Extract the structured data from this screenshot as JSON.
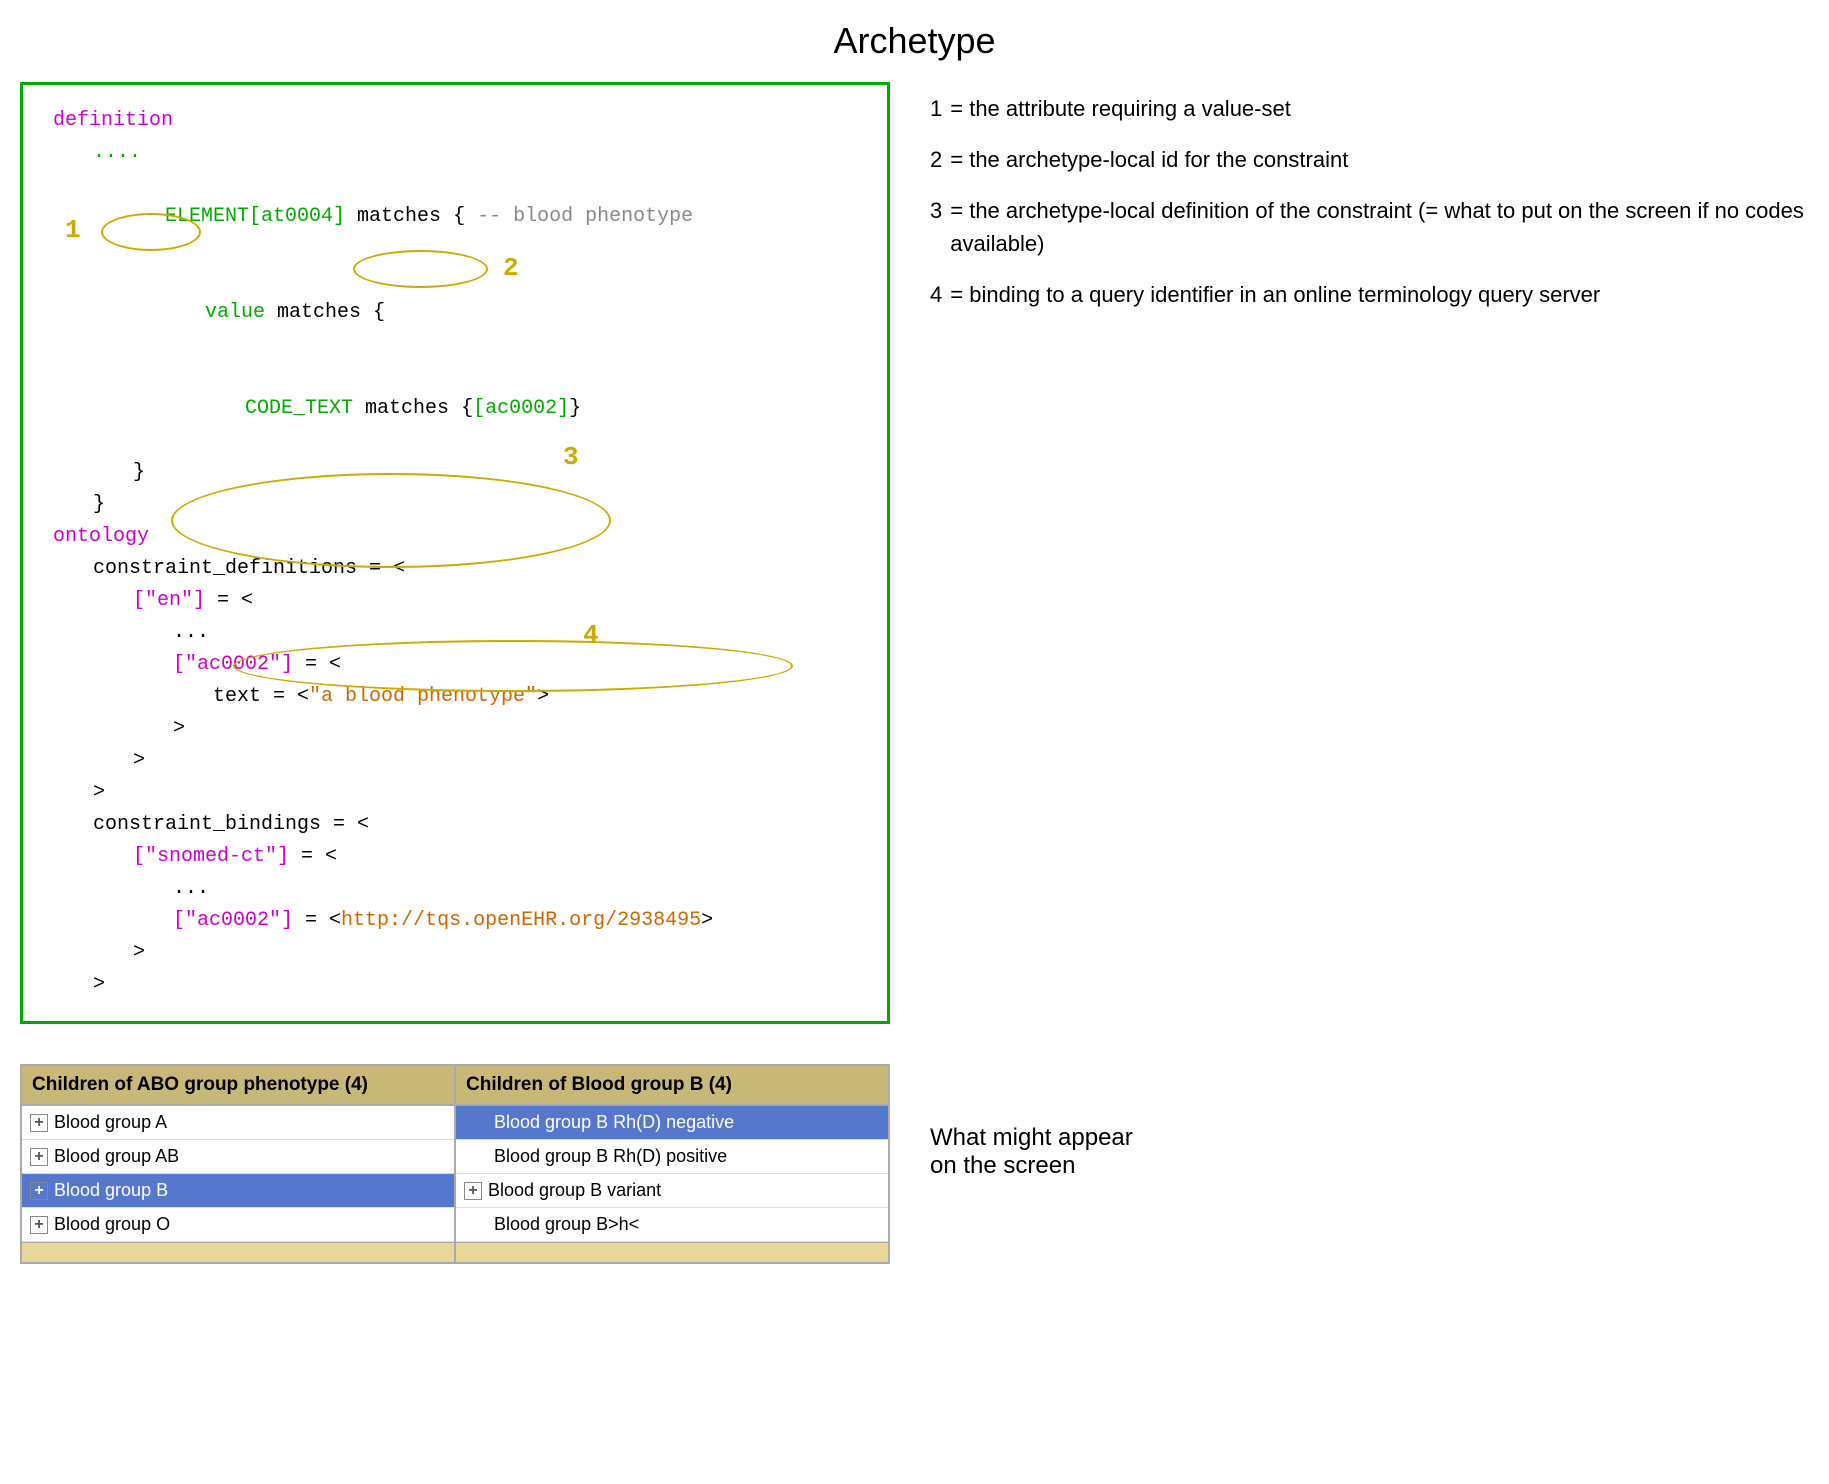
{
  "page": {
    "title": "Archetype"
  },
  "code": {
    "lines": [
      {
        "text": "definition",
        "color": "purple"
      },
      {
        "text": "    ....",
        "color": "green"
      },
      {
        "text": "    ELEMENT[at0004] matches { -- blood phenotype",
        "parts": [
          {
            "text": "    ",
            "color": "black"
          },
          {
            "text": "ELEMENT[at0004]",
            "color": "green"
          },
          {
            "text": " matches { ",
            "color": "black"
          },
          {
            "text": "-- blood phenotype",
            "color": "gray"
          }
        ]
      },
      {
        "text": "        value matches {",
        "parts": [
          {
            "text": "        ",
            "color": "black"
          },
          {
            "text": "value",
            "color": "green"
          },
          {
            "text": " matches {",
            "color": "black"
          }
        ]
      },
      {
        "text": "            CODE_TEXT matches {[ac0002]}",
        "parts": [
          {
            "text": "            ",
            "color": "black"
          },
          {
            "text": "CODE_TEXT",
            "color": "green"
          },
          {
            "text": " matches {",
            "color": "black"
          },
          {
            "text": "[ac0002]",
            "color": "green"
          },
          {
            "text": "}",
            "color": "black"
          }
        ]
      },
      {
        "text": "        }",
        "color": "black"
      },
      {
        "text": "    }",
        "color": "black"
      },
      {
        "text": "ontology",
        "color": "purple"
      },
      {
        "text": "    constraint_definitions = <",
        "color": "black"
      },
      {
        "text": "        [\"en\"] = <",
        "parts": [
          {
            "text": "        ",
            "color": "black"
          },
          {
            "text": "[\"en\"]",
            "color": "purple"
          },
          {
            "text": " = <",
            "color": "black"
          }
        ]
      },
      {
        "text": "            ...",
        "color": "black"
      },
      {
        "text": "            [\"ac0002\"] = <",
        "parts": [
          {
            "text": "            ",
            "color": "black"
          },
          {
            "text": "[\"ac0002\"]",
            "color": "purple"
          },
          {
            "text": " = <",
            "color": "black"
          }
        ]
      },
      {
        "text": "                text = <\"a blood phenotype\">",
        "parts": [
          {
            "text": "                text = <",
            "color": "black"
          },
          {
            "text": "\"a blood phenotype\"",
            "color": "orange"
          },
          {
            "text": ">",
            "color": "black"
          }
        ]
      },
      {
        "text": "            >",
        "color": "black"
      },
      {
        "text": "        >",
        "color": "black"
      },
      {
        "text": "    >",
        "color": "black"
      },
      {
        "text": "    constraint_bindings = <",
        "color": "black"
      },
      {
        "text": "        [\"snomed-ct\"] = <",
        "parts": [
          {
            "text": "        ",
            "color": "black"
          },
          {
            "text": "[\"snomed-ct\"]",
            "color": "purple"
          },
          {
            "text": " = <",
            "color": "black"
          }
        ]
      },
      {
        "text": "            ...",
        "color": "black"
      },
      {
        "text": "            [\"ac0002\"] = <http://tqs.openEHR.org/2938495>",
        "parts": [
          {
            "text": "            ",
            "color": "black"
          },
          {
            "text": "[\"ac0002\"]",
            "color": "purple"
          },
          {
            "text": " = <",
            "color": "black"
          },
          {
            "text": "http://tqs.openEHR.org/2938495",
            "color": "orange"
          },
          {
            "text": ">",
            "color": "black"
          }
        ]
      },
      {
        "text": "        >",
        "color": "black"
      },
      {
        "text": "    >",
        "color": "black"
      }
    ]
  },
  "annotations": [
    {
      "num": "1",
      "text": "= the attribute requiring a value-set"
    },
    {
      "num": "2",
      "text": "= the archetype-local id for the constraint"
    },
    {
      "num": "3",
      "text": "= the archetype-local definition of the constraint (= what to put on the screen if no codes available)"
    },
    {
      "num": "4",
      "text": "= binding to a query identifier in an online terminology query server"
    }
  ],
  "table1": {
    "header": "Children of ABO group phenotype (4)",
    "rows": [
      {
        "icon": "+",
        "label": "Blood group A",
        "selected": false
      },
      {
        "icon": "+",
        "label": "Blood group AB",
        "selected": false
      },
      {
        "icon": "+",
        "label": "Blood group B",
        "selected": true
      },
      {
        "icon": "+",
        "label": "Blood group O",
        "selected": false
      }
    ]
  },
  "table2": {
    "header": "Children of Blood group B (4)",
    "rows": [
      {
        "icon": null,
        "label": "Blood group B Rh(D) negative",
        "selected": true
      },
      {
        "icon": null,
        "label": "Blood group B Rh(D) positive",
        "selected": false
      },
      {
        "icon": "+",
        "label": "Blood group B variant",
        "selected": false
      },
      {
        "icon": null,
        "label": "Blood group B>h<",
        "selected": false
      }
    ]
  },
  "bottom_label": "What might appear\non the screen"
}
